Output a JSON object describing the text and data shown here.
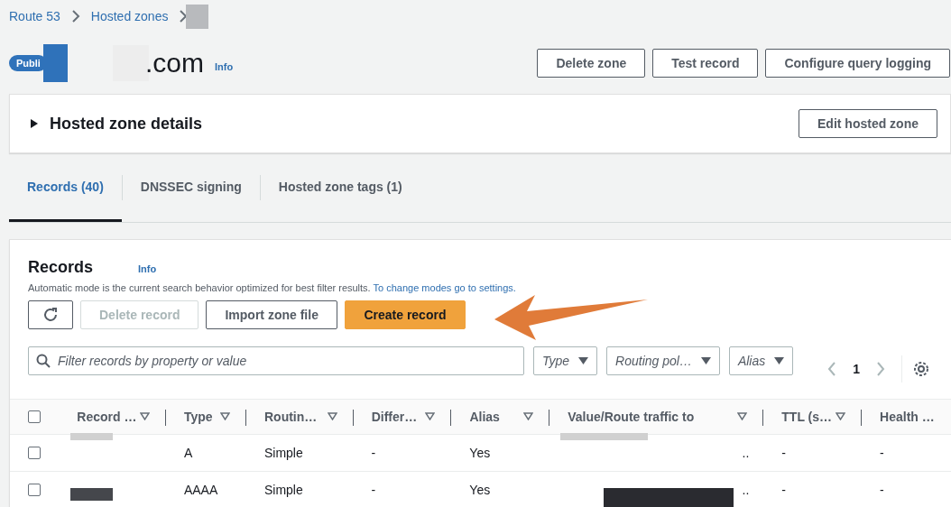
{
  "breadcrumbs": [
    {
      "label": "Route 53"
    },
    {
      "label": "Hosted zones"
    }
  ],
  "zone": {
    "badge": "Publi",
    "name": ".com",
    "info": "Info"
  },
  "header_buttons": [
    "Delete zone",
    "Test record",
    "Configure query logging"
  ],
  "details": {
    "title": "Hosted zone details",
    "expanded": false,
    "button": "Edit hosted zone"
  },
  "tabs": [
    {
      "label": "Records (40)",
      "selected": true
    },
    {
      "label": "DNSSEC signing",
      "selected": false
    },
    {
      "label": "Hosted zone tags (1)",
      "selected": false
    }
  ],
  "records": {
    "title": "Records",
    "info": "Info",
    "description": "Automatic mode is the current search behavior optimized for best filter results.",
    "link": "To change modes go to settings.",
    "actions": [
      {
        "kind": "refresh",
        "disabled": false
      },
      {
        "kind": "normal",
        "label": "Delete record",
        "disabled": true
      },
      {
        "kind": "normal",
        "label": "Import zone file",
        "disabled": false
      },
      {
        "kind": "primary",
        "label": "Create record",
        "disabled": false
      }
    ],
    "search": {
      "placeholder": "Filter records by property or value"
    },
    "filters": [
      "Type",
      "Routing pol…",
      "Alias"
    ],
    "page": "1",
    "all_checked": false,
    "columns": [
      "Record …",
      "Type",
      "Routin…",
      "Differ…",
      "Alias",
      "Value/Route traffic to",
      "TTL (s…",
      "Health …"
    ],
    "rows": [
      {
        "checked": false,
        "cells": [
          "",
          "A",
          "Simple",
          "-",
          "Yes",
          "..",
          "-",
          "-"
        ]
      },
      {
        "checked": false,
        "cells": [
          "",
          "AAAA",
          "Simple",
          "-",
          "Yes",
          "..",
          "-",
          "-"
        ]
      }
    ]
  }
}
